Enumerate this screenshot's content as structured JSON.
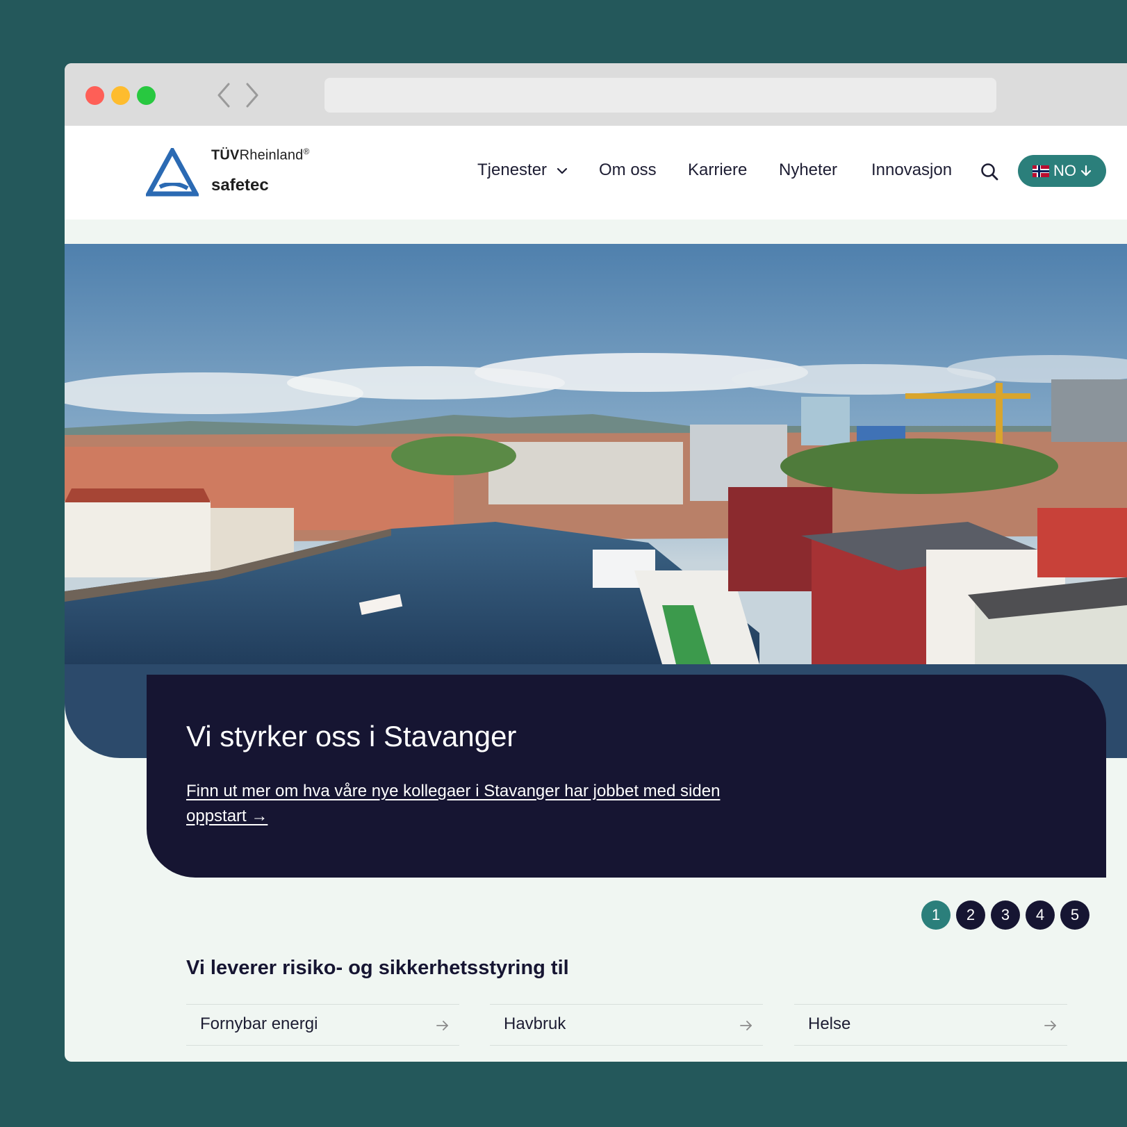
{
  "brand": {
    "logo_top_bold": "TÜV",
    "logo_top_regular": "Rheinland",
    "logo_registered": "®",
    "logo_bottom": "safetec",
    "accent_color": "#2b7f7b",
    "dark_color": "#161532"
  },
  "nav": {
    "items": [
      "Tjenester",
      "Om oss",
      "Karriere",
      "Nyheter",
      "Innovasjon"
    ],
    "language": "NO"
  },
  "hero": {
    "title": "Vi styrker oss i Stavanger",
    "link_text": "Finn ut mer om hva våre nye kollegaer i Stavanger har jobbet med siden oppstart →"
  },
  "pager": {
    "pages": [
      "1",
      "2",
      "3",
      "4",
      "5"
    ],
    "active": "1"
  },
  "sectors": {
    "title": "Vi leverer risiko- og sikkerhetsstyring til",
    "items": [
      "Fornybar energi",
      "Havbruk",
      "Helse",
      "",
      "",
      ""
    ]
  }
}
